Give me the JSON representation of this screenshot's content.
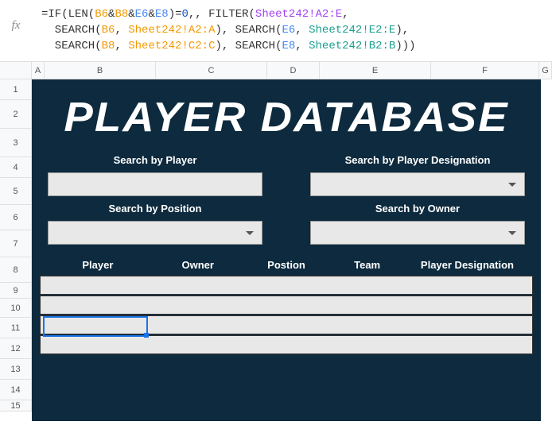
{
  "formula": {
    "line1_prefix": "=IF(LEN(",
    "ref_b6": "B6",
    "amp": "&",
    "ref_b8": "B8",
    "ref_e6": "E6",
    "ref_e8": "E8",
    "line1_mid": ")=",
    "zero": "0",
    "line1_suffix": ",, FILTER(",
    "sheet_a2e": "Sheet242!A2:E",
    "comma": ",",
    "search_open": "  SEARCH(",
    "sheet_a2a": "Sheet242!A2:A",
    "close_comma_search": "), SEARCH(",
    "sheet_e2e": "Sheet242!E2:E",
    "close_comma": "),",
    "sheet_c2c": "Sheet242!C2:C",
    "sheet_b2b": "Sheet242!B2:B",
    "close_all": ")))"
  },
  "columns": {
    "A": "A",
    "B": "B",
    "C": "C",
    "D": "D",
    "E": "E",
    "F": "F",
    "G": "G"
  },
  "rows": {
    "r1": "1",
    "r2": "2",
    "r3": "3",
    "r4": "4",
    "r5": "5",
    "r6": "6",
    "r7": "7",
    "r8": "8",
    "r9": "9",
    "r10": "10",
    "r11": "11",
    "r12": "12",
    "r13": "13",
    "r14": "14",
    "r15": "15"
  },
  "panel": {
    "title": "PLAYER DATABASE",
    "search_player": "Search by Player",
    "search_designation": "Search by Player Designation",
    "search_position": "Search by Position",
    "search_owner": "Search by Owner"
  },
  "table": {
    "player": "Player",
    "owner": "Owner",
    "position": "Postion",
    "team": "Team",
    "designation": "Player Designation"
  },
  "fx": "fx"
}
